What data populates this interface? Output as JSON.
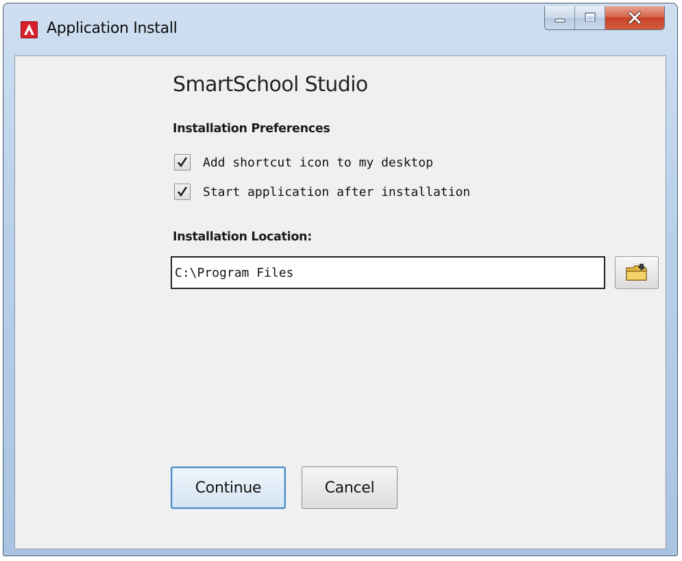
{
  "window": {
    "title": "Application Install",
    "app_icon": "adobe-air-icon",
    "controls": {
      "minimize": "minimize-icon",
      "maximize": "maximize-icon",
      "close": "close-icon"
    }
  },
  "content": {
    "app_name": "SmartSchool Studio",
    "preferences_label": "Installation Preferences",
    "options": [
      {
        "label": "Add shortcut icon to my desktop",
        "checked": true
      },
      {
        "label": "Start application after installation",
        "checked": true
      }
    ],
    "location_label": "Installation Location:",
    "location_value": "C:\\Program Files",
    "browse_icon": "folder-icon"
  },
  "buttons": {
    "continue_label": "Continue",
    "cancel_label": "Cancel"
  },
  "colors": {
    "close_button": "#c7432a",
    "app_icon": "#d7202b",
    "default_button_border": "#4a8bc5"
  }
}
